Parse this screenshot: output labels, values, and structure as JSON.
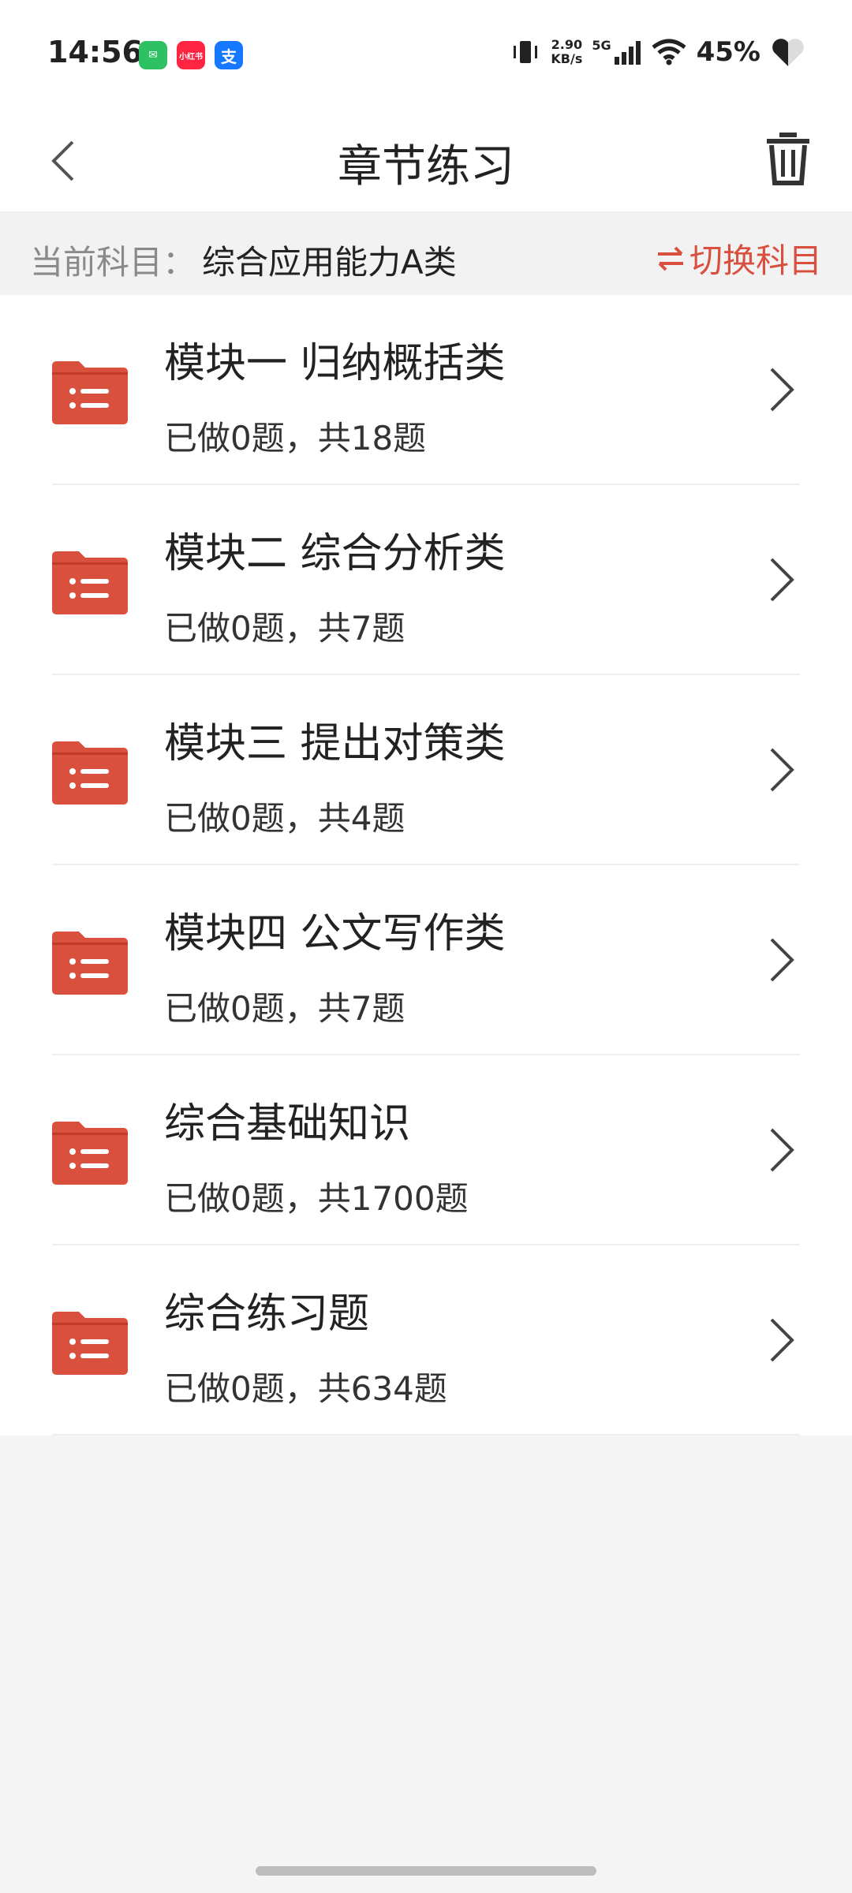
{
  "status_bar": {
    "time": "14:56",
    "apps": [
      {
        "name": "wechat-icon",
        "glyph": "✉"
      },
      {
        "name": "xiaohongshu-icon",
        "glyph": "小红书"
      },
      {
        "name": "alipay-icon",
        "glyph": "支"
      }
    ],
    "net_speed_value": "2.90",
    "net_speed_unit": "KB/s",
    "network": "5G",
    "battery": "45%"
  },
  "header": {
    "title": "章节练习"
  },
  "subject": {
    "label": "当前科目：",
    "value": "综合应用能力A类",
    "switch_label": "切换科目"
  },
  "chapters": [
    {
      "title": "模块一 归纳概括类",
      "progress": "已做0题，共18题"
    },
    {
      "title": "模块二 综合分析类",
      "progress": "已做0题，共7题"
    },
    {
      "title": "模块三 提出对策类",
      "progress": "已做0题，共4题"
    },
    {
      "title": "模块四 公文写作类",
      "progress": "已做0题，共7题"
    },
    {
      "title": "综合基础知识",
      "progress": "已做0题，共1700题"
    },
    {
      "title": "综合练习题",
      "progress": "已做0题，共634题"
    }
  ],
  "colors": {
    "accent": "#d9503f",
    "folder": "#d9503f"
  }
}
